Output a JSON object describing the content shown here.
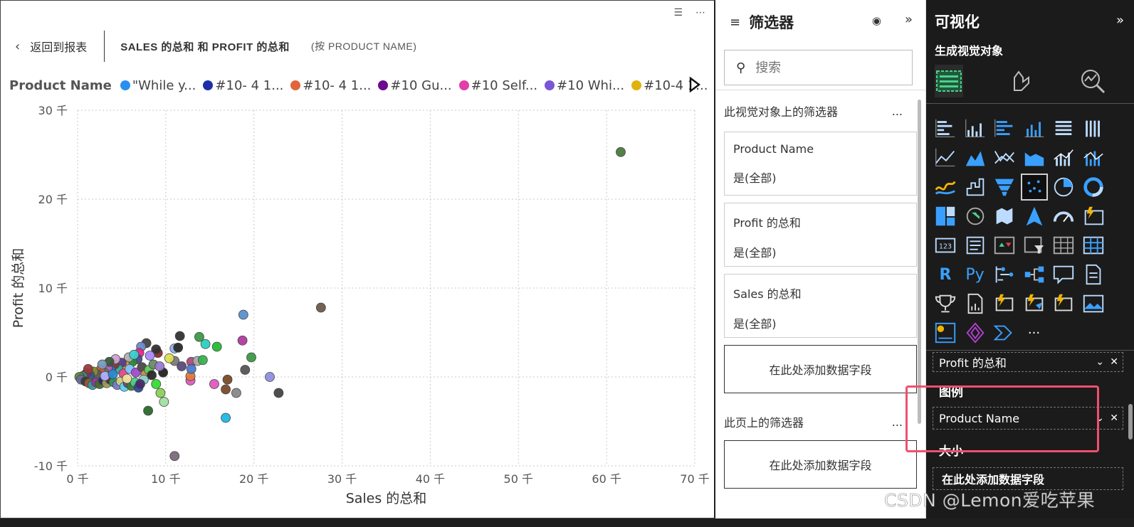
{
  "report": {
    "back_label": "返回到报表",
    "visual_title": "SALES 的总和 和 PROFIT 的总和",
    "visual_subtitle": "(按 PRODUCT NAME)",
    "legend": {
      "title": "Product Name",
      "items": [
        {
          "label": "\"While y...",
          "color": "#2b8ff0"
        },
        {
          "label": "#10- 4 1...",
          "color": "#1d2fa8"
        },
        {
          "label": "#10- 4 1...",
          "color": "#e0653a"
        },
        {
          "label": "#10 Gu...",
          "color": "#6b0a8c"
        },
        {
          "label": "#10 Self...",
          "color": "#e23fa8"
        },
        {
          "label": "#10 Whi...",
          "color": "#7a56d6"
        },
        {
          "label": "#10-4 1...",
          "color": "#e0b20d"
        }
      ]
    }
  },
  "chart_data": {
    "type": "scatter",
    "xlabel": "Sales 的总和",
    "ylabel": "Profit 的总和",
    "xlim": [
      0,
      70000
    ],
    "ylim": [
      -10000,
      30000
    ],
    "xticks": [
      0,
      10000,
      20000,
      30000,
      40000,
      50000,
      60000,
      70000
    ],
    "yticks": [
      -10000,
      0,
      10000,
      20000,
      30000
    ],
    "xtick_labels": [
      "0 千",
      "10 千",
      "20 千",
      "30 千",
      "40 千",
      "50 千",
      "60 千",
      "70 千"
    ],
    "ytick_labels": [
      "-10 千",
      "0 千",
      "10 千",
      "20 千",
      "30 千"
    ],
    "grid": true,
    "legend_position": "top",
    "points": [
      {
        "x": 61600,
        "y": 25300,
        "color": "#4a7a3c"
      },
      {
        "x": 27600,
        "y": 7800,
        "color": "#6b5a4a"
      },
      {
        "x": 18800,
        "y": 7000,
        "color": "#5b8fd0"
      },
      {
        "x": 11600,
        "y": 4600,
        "color": "#333333"
      },
      {
        "x": 13800,
        "y": 4500,
        "color": "#3a9a44"
      },
      {
        "x": 14500,
        "y": 3700,
        "color": "#2ad0c0"
      },
      {
        "x": 15800,
        "y": 3400,
        "color": "#22bb33"
      },
      {
        "x": 18700,
        "y": 4100,
        "color": "#b03aa0"
      },
      {
        "x": 19700,
        "y": 2200,
        "color": "#3a9a44"
      },
      {
        "x": 19000,
        "y": 800,
        "color": "#555555"
      },
      {
        "x": 17000,
        "y": -300,
        "color": "#7a4a2a"
      },
      {
        "x": 16800,
        "y": -1400,
        "color": "#7a4a2a"
      },
      {
        "x": 18000,
        "y": -1800,
        "color": "#888888"
      },
      {
        "x": 15500,
        "y": -800,
        "color": "#e05ac0"
      },
      {
        "x": 21800,
        "y": 0,
        "color": "#8f8fe0"
      },
      {
        "x": 22800,
        "y": -1800,
        "color": "#444444"
      },
      {
        "x": 16800,
        "y": -4600,
        "color": "#1fb8e0"
      },
      {
        "x": 9800,
        "y": -2800,
        "color": "#a0e0a0"
      },
      {
        "x": 9400,
        "y": -1800,
        "color": "#8ad05a"
      },
      {
        "x": 8000,
        "y": -3800,
        "color": "#2a6a2a"
      },
      {
        "x": 11000,
        "y": -8900,
        "color": "#7a6a7a"
      },
      {
        "x": 12800,
        "y": -400,
        "color": "#e05ac0"
      },
      {
        "x": 12800,
        "y": 100,
        "color": "#e07a3a"
      },
      {
        "x": 8900,
        "y": -800,
        "color": "#33dd33"
      },
      {
        "x": 11000,
        "y": 3200,
        "color": "#8fb0f0"
      },
      {
        "x": 11400,
        "y": 3300,
        "color": "#2a2a2a"
      },
      {
        "x": 11000,
        "y": 1800,
        "color": "#7a7a7a"
      },
      {
        "x": 11800,
        "y": 1200,
        "color": "#5a4a7a"
      },
      {
        "x": 12900,
        "y": 1700,
        "color": "#b04a7a"
      },
      {
        "x": 12900,
        "y": 900,
        "color": "#4a7ad0"
      },
      {
        "x": 13600,
        "y": 1800,
        "color": "#aaaaaa"
      },
      {
        "x": 14200,
        "y": 1900,
        "color": "#3ab050"
      },
      {
        "x": 10400,
        "y": 2100,
        "color": "#dddd55"
      },
      {
        "x": 9700,
        "y": 500,
        "color": "#222222"
      },
      {
        "x": 9100,
        "y": 2700,
        "color": "#8a2a2a"
      },
      {
        "x": 8900,
        "y": 3100,
        "color": "#333333"
      },
      {
        "x": 7800,
        "y": 3800,
        "color": "#444444"
      },
      {
        "x": 7200,
        "y": 3400,
        "color": "#6a8ad0"
      },
      {
        "x": 7000,
        "y": 2700,
        "color": "#e02a8a"
      },
      {
        "x": 8200,
        "y": 2400,
        "color": "#aa88ff"
      },
      {
        "x": 6800,
        "y": 2000,
        "color": "#4a4a8a"
      },
      {
        "x": 6200,
        "y": 1700,
        "color": "#2a8a2a"
      },
      {
        "x": 5800,
        "y": 2200,
        "color": "#b0b0b0"
      },
      {
        "x": 5400,
        "y": 1300,
        "color": "#e0a030"
      },
      {
        "x": 5000,
        "y": 1600,
        "color": "#5a3a8a"
      },
      {
        "x": 4600,
        "y": 900,
        "color": "#2ab0a0"
      },
      {
        "x": 4200,
        "y": 1400,
        "color": "#7a3a3a"
      },
      {
        "x": 3800,
        "y": 700,
        "color": "#3a6ad0"
      },
      {
        "x": 3400,
        "y": 1000,
        "color": "#c05ad0"
      },
      {
        "x": 3000,
        "y": 500,
        "color": "#4a8a4a"
      },
      {
        "x": 2600,
        "y": 800,
        "color": "#d05a3a"
      },
      {
        "x": 2200,
        "y": 300,
        "color": "#5a5a5a"
      },
      {
        "x": 1800,
        "y": 600,
        "color": "#8a8a2a"
      },
      {
        "x": 1400,
        "y": 200,
        "color": "#2a5a8a"
      },
      {
        "x": 1000,
        "y": 400,
        "color": "#8a2a6a"
      },
      {
        "x": 600,
        "y": 100,
        "color": "#3a8a6a"
      },
      {
        "x": 200,
        "y": 0,
        "color": "#5a8a3a"
      },
      {
        "x": 400,
        "y": -300,
        "color": "#6a6a9a"
      },
      {
        "x": 900,
        "y": -500,
        "color": "#3a3a3a"
      },
      {
        "x": 1300,
        "y": -700,
        "color": "#9a5a3a"
      },
      {
        "x": 1700,
        "y": -900,
        "color": "#3a9a9a"
      },
      {
        "x": 2100,
        "y": -600,
        "color": "#8a3a9a"
      },
      {
        "x": 2500,
        "y": -800,
        "color": "#4a6a2a"
      },
      {
        "x": 2900,
        "y": -400,
        "color": "#2a2a6a"
      },
      {
        "x": 3300,
        "y": -700,
        "color": "#9a9a5a"
      },
      {
        "x": 3700,
        "y": -300,
        "color": "#5a2a2a"
      },
      {
        "x": 4100,
        "y": -600,
        "color": "#2a9a5a"
      },
      {
        "x": 4500,
        "y": -900,
        "color": "#7a7ad0"
      },
      {
        "x": 4900,
        "y": -500,
        "color": "#d0d080"
      },
      {
        "x": 5300,
        "y": -1100,
        "color": "#5ad0f0"
      },
      {
        "x": 5700,
        "y": -700,
        "color": "#6a4a6a"
      },
      {
        "x": 6100,
        "y": -1000,
        "color": "#3a7a3a"
      },
      {
        "x": 6500,
        "y": -600,
        "color": "#4ad08a"
      },
      {
        "x": 6900,
        "y": -1200,
        "color": "#2a4a9a"
      },
      {
        "x": 5200,
        "y": 400,
        "color": "#e04a8a"
      },
      {
        "x": 5900,
        "y": 900,
        "color": "#80c0ff"
      },
      {
        "x": 6600,
        "y": 500,
        "color": "#a04ad0"
      },
      {
        "x": 7300,
        "y": 1100,
        "color": "#4a4a4a"
      },
      {
        "x": 7700,
        "y": 300,
        "color": "#d08a3a"
      },
      {
        "x": 8100,
        "y": 800,
        "color": "#5ad05a"
      },
      {
        "x": 8400,
        "y": 200,
        "color": "#2a2a2a"
      },
      {
        "x": 7500,
        "y": -300,
        "color": "#8ad0d0"
      },
      {
        "x": 8600,
        "y": 1400,
        "color": "#6a8a6a"
      },
      {
        "x": 9300,
        "y": 1200,
        "color": "#9a7ad0"
      },
      {
        "x": 4300,
        "y": 2000,
        "color": "#d0a0d0"
      },
      {
        "x": 3600,
        "y": 1700,
        "color": "#3a5a3a"
      },
      {
        "x": 2800,
        "y": 1400,
        "color": "#7a9aba"
      },
      {
        "x": 3100,
        "y": 100,
        "color": "#b0b0ff"
      },
      {
        "x": 4000,
        "y": 300,
        "color": "#2a8ad0"
      },
      {
        "x": 1200,
        "y": 900,
        "color": "#9a3a3a"
      },
      {
        "x": 6400,
        "y": 2500,
        "color": "#3ad0d0"
      },
      {
        "x": 5600,
        "y": -200,
        "color": "#f0e0a0"
      },
      {
        "x": 7100,
        "y": -800,
        "color": "#4a2a6a"
      }
    ]
  },
  "filters_pane": {
    "title": "筛选器",
    "search_placeholder": "搜索",
    "visual_section_title": "此视觉对象上的筛选器",
    "more_label": "...",
    "cards": [
      {
        "name": "Product Name",
        "value": "是(全部)"
      },
      {
        "name": "Profit 的总和",
        "value": "是(全部)"
      },
      {
        "name": "Sales 的总和",
        "value": "是(全部)"
      }
    ],
    "add_field_label": "在此处添加数据字段",
    "page_section_title": "此页上的筛选器",
    "page_add_field_label": "在此处添加数据字段"
  },
  "viz_pane": {
    "title": "可视化",
    "build_label": "生成视觉对象",
    "r_label": "R",
    "py_label": "Py",
    "more_visuals": "···",
    "wells": {
      "y_field": "Profit 的总和",
      "legend_label": "图例",
      "legend_field": "Product Name",
      "size_label": "大小",
      "size_drop": "在此处添加数据字段"
    }
  },
  "watermark": "CSDN @Lemon爱吃苹果"
}
